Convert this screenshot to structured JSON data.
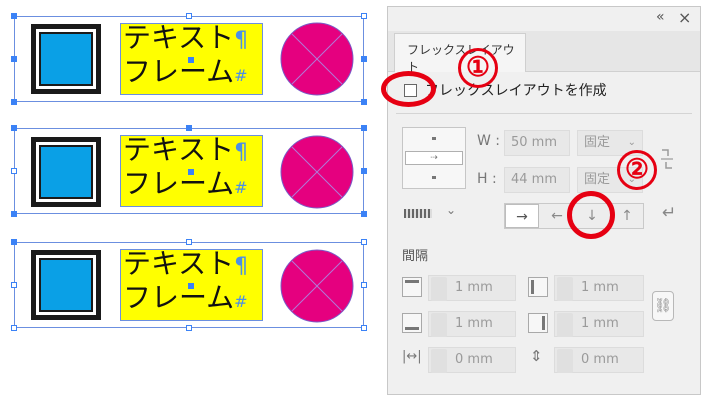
{
  "canvas": {
    "text_line_1": "テキスト",
    "text_line_2": "フレーム",
    "pilcrow": "¶",
    "hash": "#",
    "colors": {
      "square": "#0aa0e6",
      "circle": "#e5007f",
      "textframe": "#ffff00",
      "selection": "#3b82f6"
    }
  },
  "panel": {
    "collapse_glyph": "«",
    "close_glyph": "×",
    "tab_label": "フレックスレイアウト",
    "create_label": "フレックスレイアウトを作成",
    "width_label": "W :",
    "width_value": "50 mm",
    "width_mode": "固定",
    "height_label": "H :",
    "height_value": "44 mm",
    "height_mode": "固定",
    "spacing_heading": "間隔",
    "spacing": {
      "top": "1 mm",
      "left": "1 mm",
      "bottom": "1 mm",
      "right": "1 mm",
      "horizontal_gap": "0 mm",
      "vertical_gap": "0 mm"
    },
    "direction_buttons": [
      "→",
      "←",
      "↓",
      "↑"
    ],
    "wrap_glyph": "↵"
  },
  "annotations": {
    "one": "①",
    "two": "②",
    "color": "#e60012"
  }
}
